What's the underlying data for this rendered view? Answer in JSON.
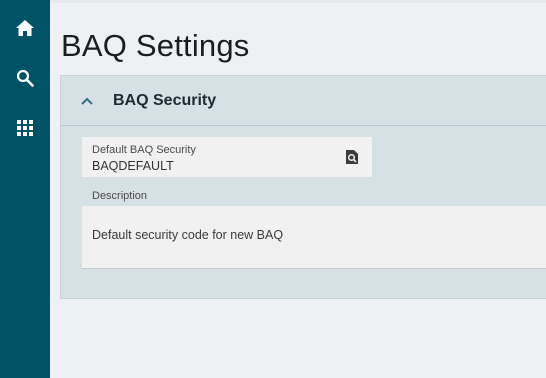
{
  "sidebar": {
    "items": [
      {
        "icon": "home-icon"
      },
      {
        "icon": "search-icon"
      },
      {
        "icon": "apps-grid-icon"
      }
    ]
  },
  "page": {
    "title": "BAQ Settings"
  },
  "panel": {
    "title": "BAQ Security",
    "expanded": true,
    "fields": {
      "default_security": {
        "label": "Default BAQ Security",
        "value": "BAQDEFAULT",
        "icon": "lookup-search-icon"
      },
      "description": {
        "label": "Description",
        "value": "Default security code for new BAQ"
      }
    }
  },
  "colors": {
    "sidebar": "#005365",
    "panel_background": "#d6e1e5",
    "page_background": "#eef1f3",
    "field_background": "#f1f1f1",
    "accent": "#2f6f86"
  }
}
